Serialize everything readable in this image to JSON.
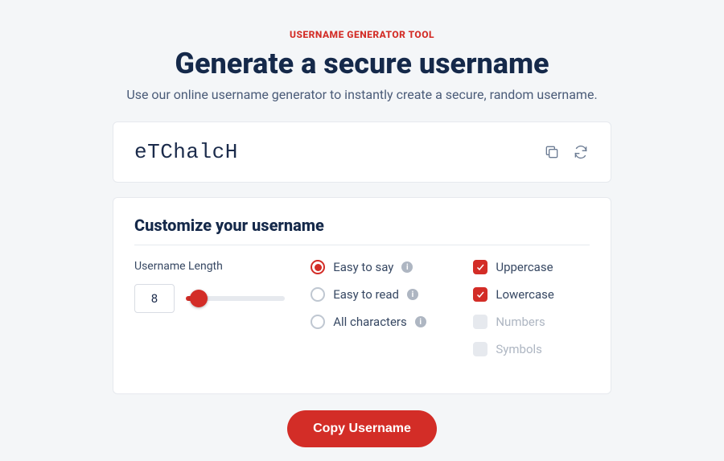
{
  "header": {
    "eyebrow": "USERNAME GENERATOR TOOL",
    "title": "Generate a secure username",
    "subtitle": "Use our online username generator to instantly create a secure, random username."
  },
  "generated": {
    "value": "eTChalcH"
  },
  "settings": {
    "title": "Customize your username",
    "length_label": "Username Length",
    "length_value": "8",
    "modes": {
      "easy_say": "Easy to say",
      "easy_read": "Easy to read",
      "all_chars": "All characters"
    },
    "chars": {
      "uppercase": "Uppercase",
      "lowercase": "Lowercase",
      "numbers": "Numbers",
      "symbols": "Symbols"
    }
  },
  "cta": {
    "copy": "Copy Username"
  }
}
